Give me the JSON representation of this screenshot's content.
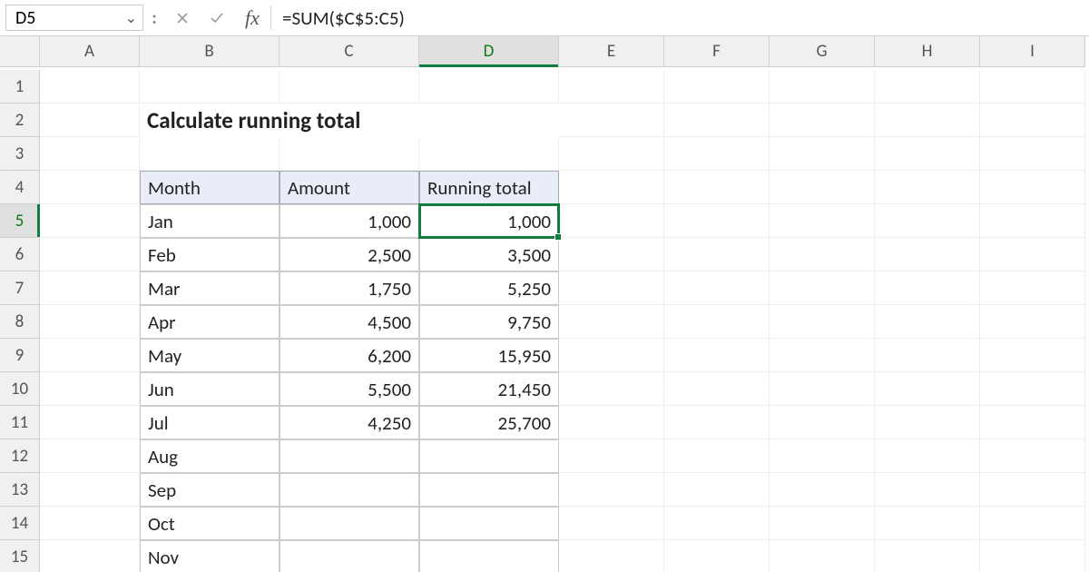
{
  "namebox": {
    "value": "D5"
  },
  "formula": {
    "value": "=SUM($C$5:C5)"
  },
  "columns": [
    "A",
    "B",
    "C",
    "D",
    "E",
    "F",
    "G",
    "H",
    "I"
  ],
  "active_col": "D",
  "active_row": 5,
  "row_count": 15,
  "title": "Calculate running total",
  "table": {
    "headers": {
      "month": "Month",
      "amount": "Amount",
      "running": "Running total"
    },
    "rows": [
      {
        "month": "Jan",
        "amount": "1,000",
        "running": "1,000"
      },
      {
        "month": "Feb",
        "amount": "2,500",
        "running": "3,500"
      },
      {
        "month": "Mar",
        "amount": "1,750",
        "running": "5,250"
      },
      {
        "month": "Apr",
        "amount": "4,500",
        "running": "9,750"
      },
      {
        "month": "May",
        "amount": "6,200",
        "running": "15,950"
      },
      {
        "month": "Jun",
        "amount": "5,500",
        "running": "21,450"
      },
      {
        "month": "Jul",
        "amount": "4,250",
        "running": "25,700"
      },
      {
        "month": "Aug",
        "amount": "",
        "running": ""
      },
      {
        "month": "Sep",
        "amount": "",
        "running": ""
      },
      {
        "month": "Oct",
        "amount": "",
        "running": ""
      },
      {
        "month": "Nov",
        "amount": "",
        "running": ""
      }
    ]
  },
  "icons": {
    "chevron": "⌄",
    "cancel": "✕",
    "enter": "✓",
    "fx": "fx"
  }
}
